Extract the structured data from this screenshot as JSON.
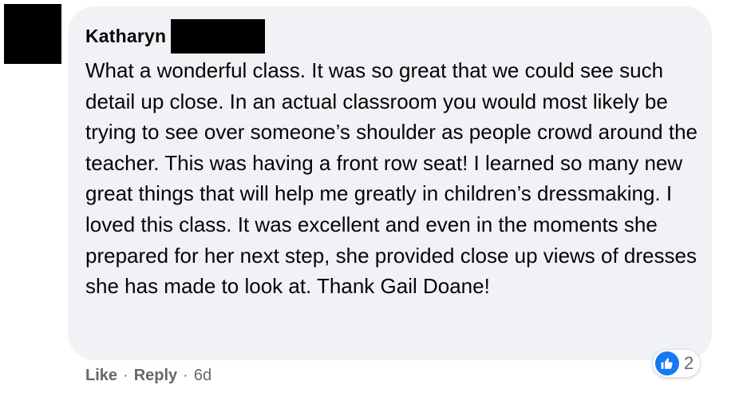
{
  "comment": {
    "author": "Katharyn",
    "text": "What a wonderful class. It was so great that we could see such detail up close. In an actual classroom you would most likely be trying to see over someone’s shoulder as people crowd around the teacher. This was having a front row seat! I learned so many new great things that will help me greatly in children’s dressmaking. I loved this class. It was excellent and even in the moments she prepared for her next step, she provided close up views of dresses she has made to look at. Thank Gail Doane!"
  },
  "reactions": {
    "icon": "thumbs-up-icon",
    "count": "2",
    "color": "#1877f2"
  },
  "actions": {
    "like_label": "Like",
    "reply_label": "Reply",
    "separator": "·",
    "timestamp": "6d"
  }
}
